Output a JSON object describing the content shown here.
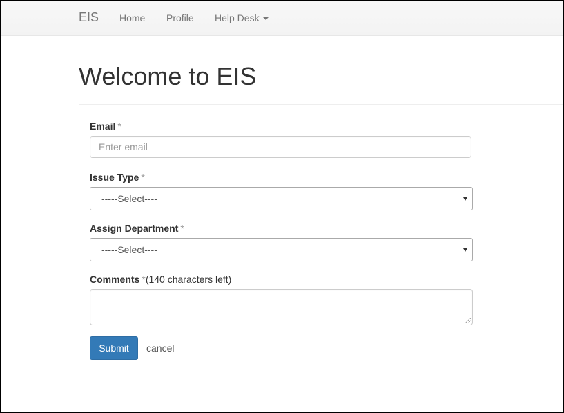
{
  "navbar": {
    "brand": "EIS",
    "links": [
      {
        "label": "Home"
      },
      {
        "label": "Profile"
      },
      {
        "label": "Help Desk"
      }
    ]
  },
  "page": {
    "title": "Welcome to EIS"
  },
  "form": {
    "required_marker": "*",
    "email": {
      "label": "Email",
      "placeholder": "Enter email",
      "value": ""
    },
    "issue_type": {
      "label": "Issue Type",
      "selected": "-----Select----"
    },
    "assign_department": {
      "label": "Assign Department",
      "selected": "-----Select----"
    },
    "comments": {
      "label": "Comments",
      "hint": "(140 characters left)",
      "value": ""
    },
    "submit_label": "Submit",
    "cancel_label": "cancel"
  },
  "colors": {
    "primary_button": "#337ab7",
    "navbar_bg": "#f8f8f8"
  }
}
